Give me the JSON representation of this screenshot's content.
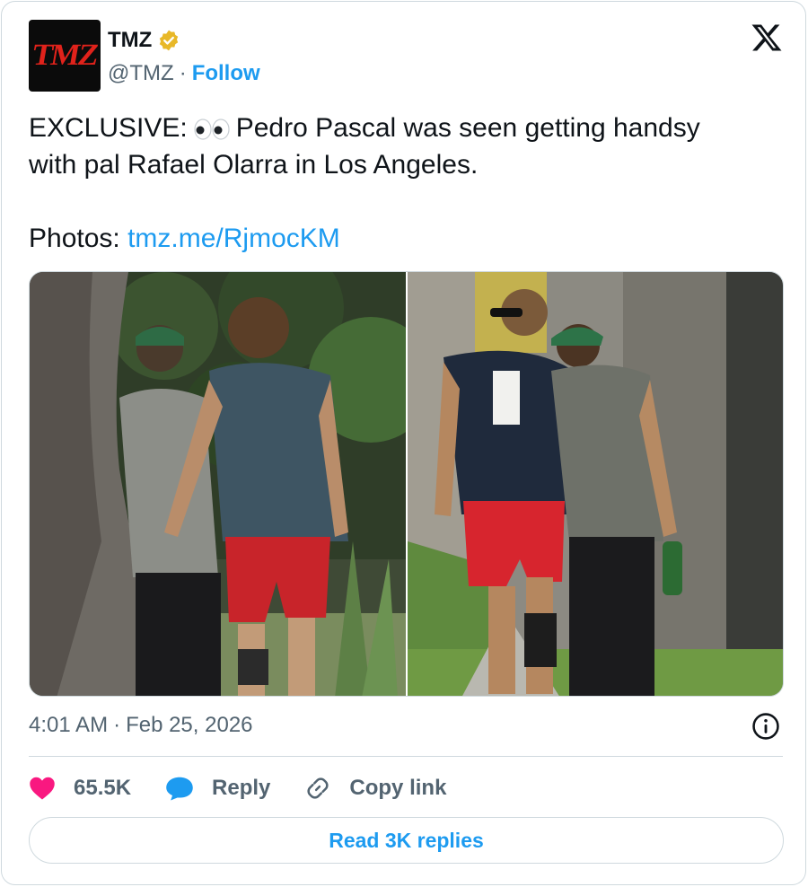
{
  "author": {
    "avatar_text": "TMZ",
    "name": "TMZ",
    "handle": "@TMZ",
    "follow_label": "Follow",
    "verified_color": "#e8b828"
  },
  "tweet": {
    "line1_before": "EXCLUSIVE:",
    "line1_after": "Pedro Pascal was seen getting handsy",
    "line2": "with pal Rafael Olarra in Los Angeles.",
    "photos_label": "Photos:",
    "link": "tmz.me/RjmocKM"
  },
  "meta": {
    "time": "4:01 AM",
    "separator": "·",
    "date": "Feb 25, 2026"
  },
  "actions": {
    "likes": "65.5K",
    "reply_label": "Reply",
    "copy_link_label": "Copy link",
    "read_replies_label": "Read 3K replies"
  },
  "icons": [
    "tmz-logo-icon",
    "verified-badge-icon",
    "x-logo-icon",
    "eyes-emoji-icon",
    "info-icon",
    "heart-icon",
    "reply-bubble-icon",
    "link-icon"
  ],
  "colors": {
    "accent": "#1d9bf0",
    "heart": "#f91880",
    "muted": "#536471",
    "border": "#cfd9de"
  }
}
